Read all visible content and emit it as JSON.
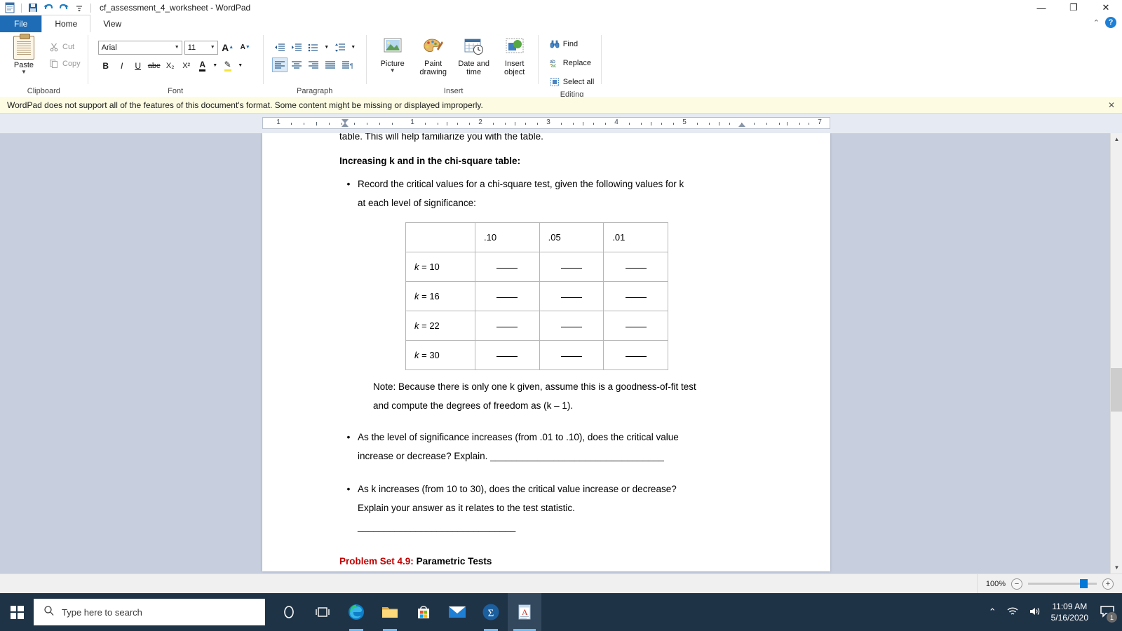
{
  "window": {
    "title": "cf_assessment_4_worksheet - WordPad",
    "quick_access": [
      "wordpad-icon",
      "save-icon",
      "undo-icon",
      "redo-icon",
      "customize-qat-icon"
    ],
    "controls": {
      "minimize": "—",
      "restore": "❐",
      "close": "✕"
    },
    "ribbon_collapse": "⌃",
    "help": "?"
  },
  "tabs": [
    {
      "id": "file",
      "label": "File"
    },
    {
      "id": "home",
      "label": "Home"
    },
    {
      "id": "view",
      "label": "View"
    }
  ],
  "ribbon": {
    "clipboard": {
      "label": "Clipboard",
      "paste": "Paste",
      "cut": "Cut",
      "copy": "Copy"
    },
    "font": {
      "label": "Font",
      "family_value": "Arial",
      "size_value": "11",
      "grow": "A",
      "shrink": "A",
      "bold": "B",
      "italic": "I",
      "underline": "U",
      "strikethrough": "abc",
      "subscript": "X₂",
      "superscript": "X²",
      "text_color": "A",
      "highlight": "✎"
    },
    "paragraph": {
      "label": "Paragraph",
      "decrease_indent": "⇤",
      "increase_indent": "⇥",
      "start_list": "•≡",
      "line_spacing": "↕≡",
      "align_left": "≡",
      "align_center": "≡",
      "align_right": "≡",
      "justify": "≡",
      "paragraph_settings": "¶"
    },
    "insert": {
      "label": "Insert",
      "picture": "Picture",
      "paint_drawing": "Paint drawing",
      "date_and_time": "Date and time",
      "insert_object": "Insert object"
    },
    "editing": {
      "label": "Editing",
      "find": "Find",
      "replace": "Replace",
      "select_all": "Select all"
    }
  },
  "notification": {
    "message": "WordPad does not support all of the features of this document's format. Some content might be missing or displayed improperly.",
    "close": "✕"
  },
  "ruler": {
    "numbers": [
      "1",
      "1",
      "2",
      "3",
      "4",
      "5",
      "7"
    ],
    "unit": "inches"
  },
  "document": {
    "clipped_top_line": "table.  This will help familiarize you with the table.",
    "heading": "Increasing k and  in the chi-square table:",
    "bullet1_line1": "Record the critical values for a chi-square test, given the following values for k",
    "bullet1_line2": "at each level of significance:",
    "table": {
      "headers": [
        "",
        ".10",
        ".05",
        ".01"
      ],
      "rows": [
        {
          "label": "k = 10",
          "cells": [
            "____",
            "____",
            "____"
          ]
        },
        {
          "label": "k = 16",
          "cells": [
            "____",
            "____",
            "____"
          ]
        },
        {
          "label": "k = 22",
          "cells": [
            "____",
            "____",
            "____"
          ]
        },
        {
          "label": "k = 30",
          "cells": [
            "____",
            "____",
            "____"
          ]
        }
      ]
    },
    "note_line1": "Note:  Because there is only one k given, assume this is a goodness-of-fit test",
    "note_line2": "and compute the degrees of freedom as (k – 1).",
    "bullet2_line1": "As the level of significance increases (from .01 to .10), does the critical value",
    "bullet2_line2": "increase or decrease? Explain.",
    "bullet2_blank": "_________________________________",
    "bullet3_line1": "As k increases (from 10 to 30), does the critical value increase or decrease?",
    "bullet3_line2": "Explain your answer as it relates to the test statistic.",
    "bullet3_blank": "______________________________",
    "problem_set_label": "Problem Set 4.9:",
    "problem_set_title": "Parametric Tests"
  },
  "statusbar": {
    "zoom_percent": "100%",
    "zoom_out": "−",
    "zoom_in": "+"
  },
  "taskbar": {
    "start": "start-button",
    "search_placeholder": "Type here to search",
    "items": [
      {
        "name": "cortana-icon",
        "glyph": "○"
      },
      {
        "name": "task-view-icon",
        "glyph": "⌸"
      },
      {
        "name": "microsoft-edge-icon",
        "glyph": ""
      },
      {
        "name": "file-explorer-icon",
        "glyph": ""
      },
      {
        "name": "microsoft-store-icon",
        "glyph": ""
      },
      {
        "name": "mail-icon",
        "glyph": ""
      },
      {
        "name": "spss-icon",
        "glyph": "Σ"
      },
      {
        "name": "wordpad-icon",
        "glyph": ""
      }
    ],
    "tray": {
      "show_hidden": "⌃",
      "network": "wifi-icon",
      "volume": "speaker-icon",
      "time": "11:09 AM",
      "date": "5/16/2020",
      "notification_count": "1"
    }
  },
  "colors": {
    "file_tab_blue": "#1d6cb5",
    "notice_yellow": "#fdfce3",
    "heading_red": "#c00000",
    "taskbar": "#1f3347",
    "accent": "#0078d7"
  }
}
